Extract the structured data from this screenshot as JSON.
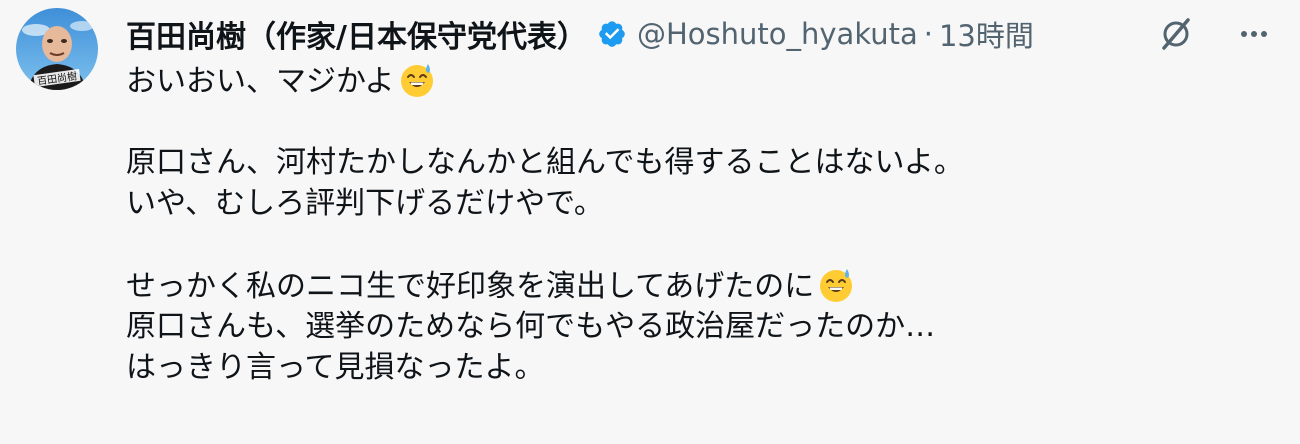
{
  "author": {
    "display_name": "百田尚樹（作家/日本保守党代表）",
    "handle": "@Hoshuto_hyakuta",
    "separator": "·",
    "time": "13時間",
    "avatar_text": "百田尚樹",
    "verified": true,
    "verified_color": "#1d9bf0"
  },
  "tweet": {
    "lines": [
      "おいおい、マジかよ",
      "",
      "原口さん、河村たかしなんかと組んでも得することはないよ。",
      "いや、むしろ評判下げるだけやで。",
      "",
      "せっかく私のニコ生で好印象を演出してあげたのに",
      "原口さんも、選挙のためなら何でもやる政治屋だったのか…",
      "はっきり言って見損なったよ。"
    ],
    "emoji": "grinning-face-with-sweat"
  },
  "actions": {
    "grok_icon": "grok-icon",
    "more_icon": "more-icon"
  },
  "colors": {
    "text": "#0f1419",
    "secondary": "#536471",
    "background": "#f7f7f7"
  }
}
